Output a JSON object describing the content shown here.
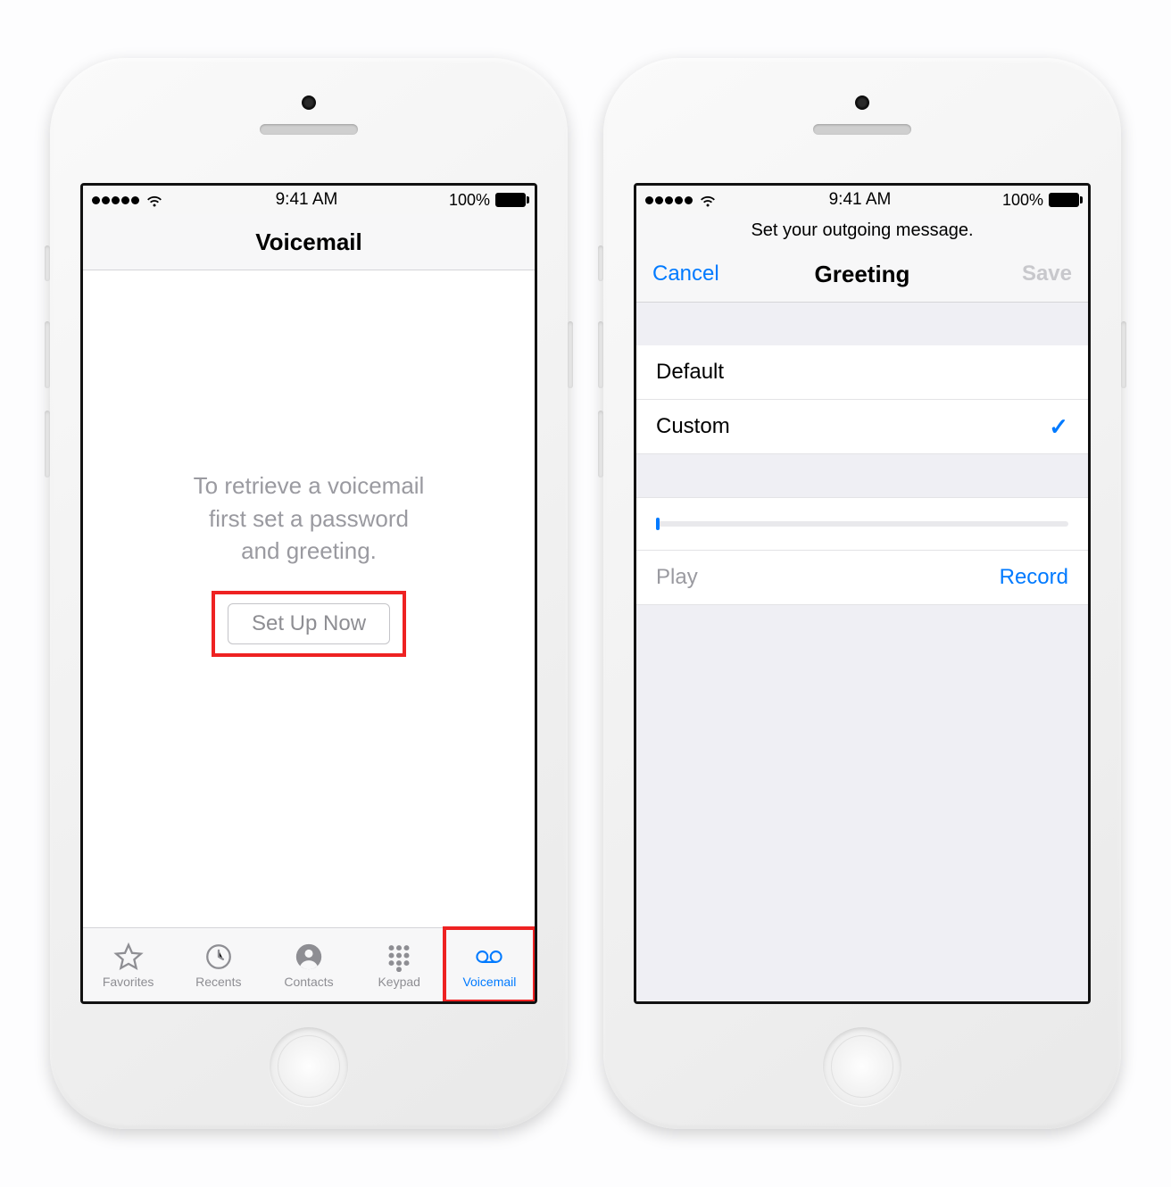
{
  "status": {
    "time": "9:41 AM",
    "battery": "100%"
  },
  "left_screen": {
    "title": "Voicemail",
    "message_l1": "To retrieve a voicemail",
    "message_l2": "first set a password",
    "message_l3": "and greeting.",
    "setup_button": "Set Up Now",
    "tabs": {
      "favorites": "Favorites",
      "recents": "Recents",
      "contacts": "Contacts",
      "keypad": "Keypad",
      "voicemail": "Voicemail"
    }
  },
  "right_screen": {
    "subhead": "Set your outgoing message.",
    "cancel": "Cancel",
    "title": "Greeting",
    "save": "Save",
    "row_default": "Default",
    "row_custom": "Custom",
    "play": "Play",
    "record": "Record"
  }
}
